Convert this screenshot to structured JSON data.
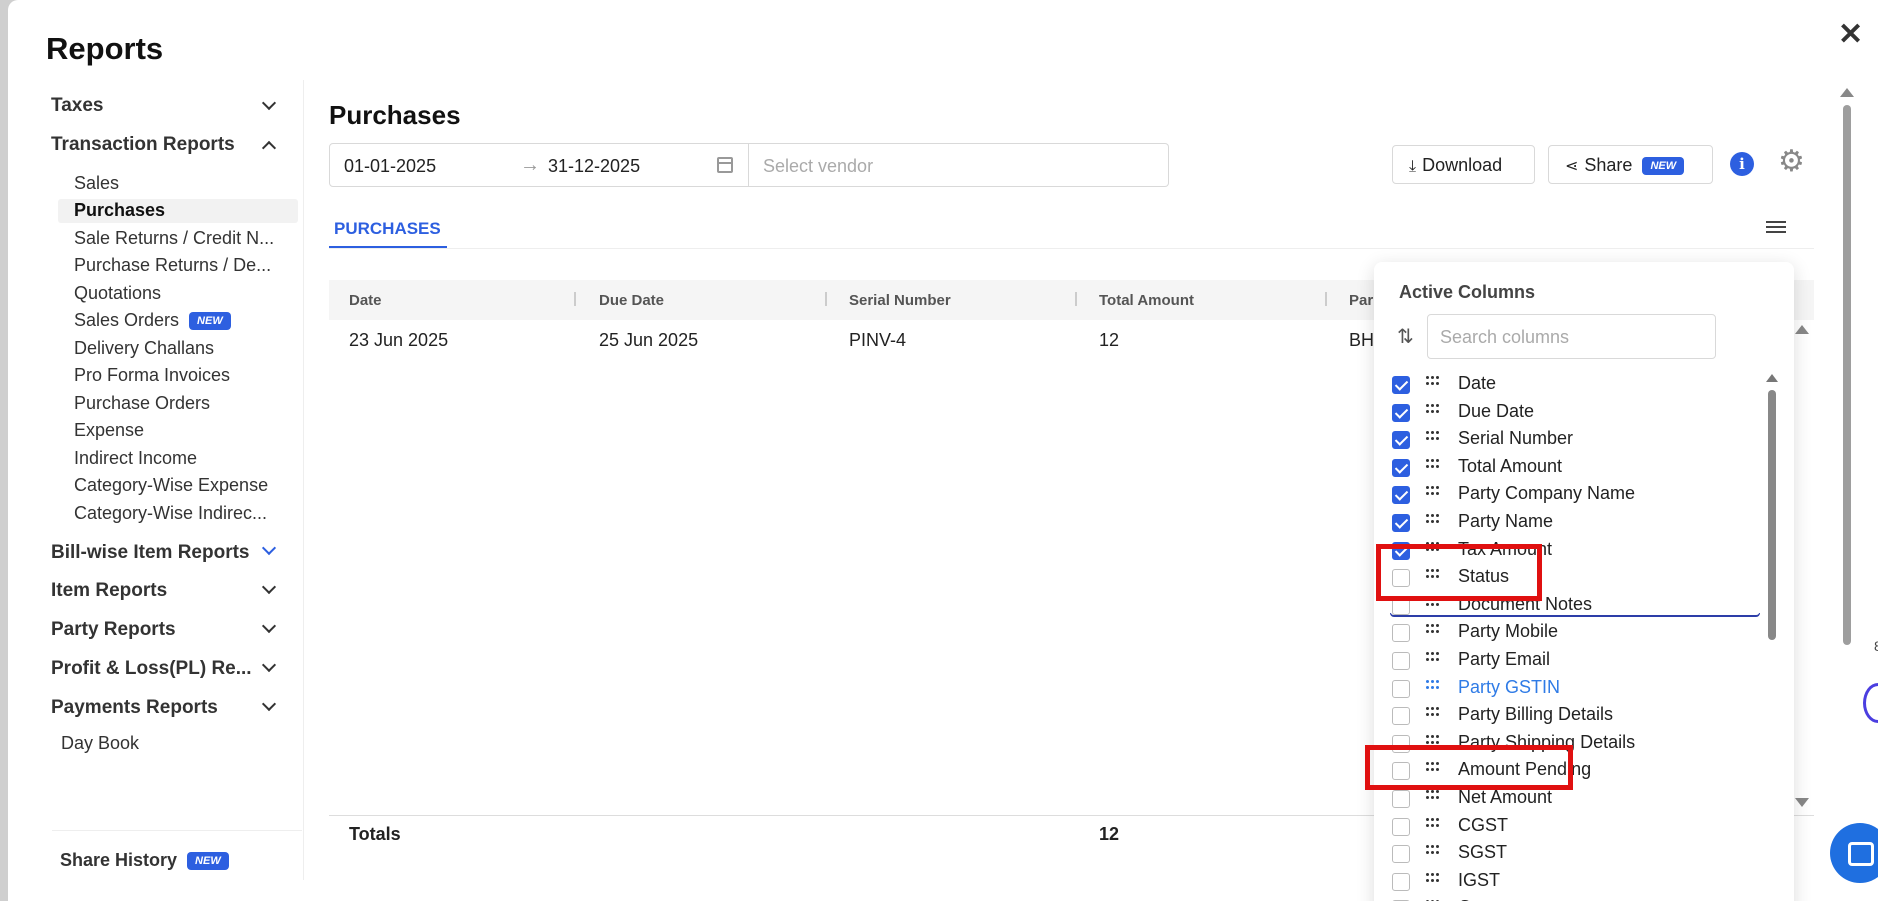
{
  "app": {
    "title": "Reports",
    "close_icon": "close-icon"
  },
  "sidebar": {
    "sections": [
      {
        "label": "Taxes",
        "state": "collapsed"
      },
      {
        "label": "Transaction Reports",
        "state": "expanded"
      },
      {
        "label": "Bill-wise Item Reports",
        "state": "collapsed"
      },
      {
        "label": "Item Reports",
        "state": "collapsed"
      },
      {
        "label": "Party Reports",
        "state": "collapsed"
      },
      {
        "label": "Profit & Loss(PL) Re...",
        "state": "collapsed"
      },
      {
        "label": "Payments Reports",
        "state": "collapsed"
      }
    ],
    "items": [
      {
        "label": "Sales"
      },
      {
        "label": "Purchases",
        "active": true
      },
      {
        "label": "Sale Returns / Credit N..."
      },
      {
        "label": "Purchase Returns / De..."
      },
      {
        "label": "Quotations"
      },
      {
        "label": "Sales Orders",
        "badge": "NEW"
      },
      {
        "label": "Delivery Challans"
      },
      {
        "label": "Pro Forma Invoices"
      },
      {
        "label": "Purchase Orders"
      },
      {
        "label": "Expense"
      },
      {
        "label": "Indirect Income"
      },
      {
        "label": "Category-Wise Expense"
      },
      {
        "label": "Category-Wise Indirec..."
      }
    ],
    "day_book": "Day Book",
    "share_history": {
      "label": "Share History",
      "badge": "NEW"
    }
  },
  "main": {
    "title": "Purchases",
    "date_from": "01-01-2025",
    "date_arrow": "→",
    "date_to": "31-12-2025",
    "vendor_placeholder": "Select vendor",
    "download_label": "Download",
    "share_label": "Share",
    "share_badge": "NEW",
    "info_glyph": "i",
    "tab": "PURCHASES",
    "columns": [
      "Date",
      "Due Date",
      "Serial Number",
      "Total Amount",
      "Par"
    ],
    "rows": [
      [
        "23 Jun 2025",
        "25 Jun 2025",
        "PINV-4",
        "12",
        "BH"
      ]
    ],
    "totals_label": "Totals",
    "totals_amount": "12"
  },
  "column_panel": {
    "title": "Active Columns",
    "search_placeholder": "Search columns",
    "items": [
      {
        "label": "Date",
        "checked": true
      },
      {
        "label": "Due Date",
        "checked": true
      },
      {
        "label": "Serial Number",
        "checked": true
      },
      {
        "label": "Total Amount",
        "checked": true
      },
      {
        "label": "Party Company Name",
        "checked": true
      },
      {
        "label": "Party Name",
        "checked": true
      },
      {
        "label": "Tax Amount",
        "checked": true
      },
      {
        "label": "Status",
        "checked": false
      },
      {
        "label": "Document Notes",
        "checked": false
      },
      {
        "label": "Party Mobile",
        "checked": false
      },
      {
        "label": "Party Email",
        "checked": false
      },
      {
        "label": "Party GSTIN",
        "checked": false,
        "highlight": true
      },
      {
        "label": "Party Billing Details",
        "checked": false
      },
      {
        "label": "Party Shipping Details",
        "checked": false
      },
      {
        "label": "Amount Pending",
        "checked": false
      },
      {
        "label": "Net Amount",
        "checked": false
      },
      {
        "label": "CGST",
        "checked": false
      },
      {
        "label": "SGST",
        "checked": false
      },
      {
        "label": "IGST",
        "checked": false
      },
      {
        "label": "C",
        "checked": false
      }
    ]
  },
  "colors": {
    "accent": "#2d5fe0",
    "highlight": "#e01010",
    "link": "#2f7be6"
  }
}
